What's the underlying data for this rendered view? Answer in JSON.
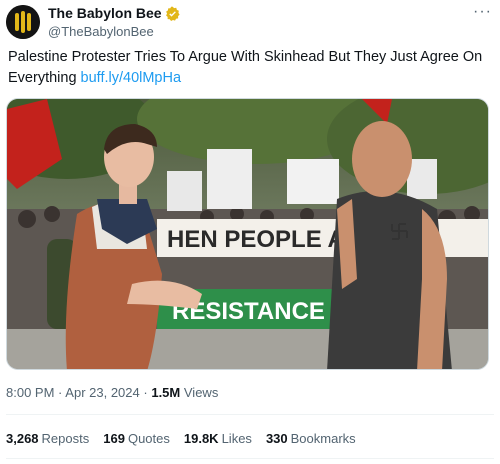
{
  "account": {
    "display_name": "The Babylon Bee",
    "handle": "@TheBabylonBee",
    "verified_color": "#e2b719"
  },
  "tweet": {
    "text": "Palestine Protester Tries To Argue With Skinhead But They Just Agree On Everything",
    "link": "buff.ly/40lMpHa",
    "more_label": "···"
  },
  "media": {
    "description_icon": "photo",
    "sign_lines": [
      "HEN PEOPLE ARE C",
      "RESISTANCE"
    ]
  },
  "meta": {
    "time": "8:00 PM",
    "date": "Apr 23, 2024",
    "views_count": "1.5M",
    "views_label": "Views",
    "separator": "·"
  },
  "stats": {
    "reposts_count": "3,268",
    "reposts_label": "Reposts",
    "quotes_count": "169",
    "quotes_label": "Quotes",
    "likes_count": "19.8K",
    "likes_label": "Likes",
    "bookmarks_count": "330",
    "bookmarks_label": "Bookmarks"
  },
  "colors": {
    "link": "#1d9bf0",
    "secondary_text": "#536471",
    "primary_text": "#0f1419"
  }
}
